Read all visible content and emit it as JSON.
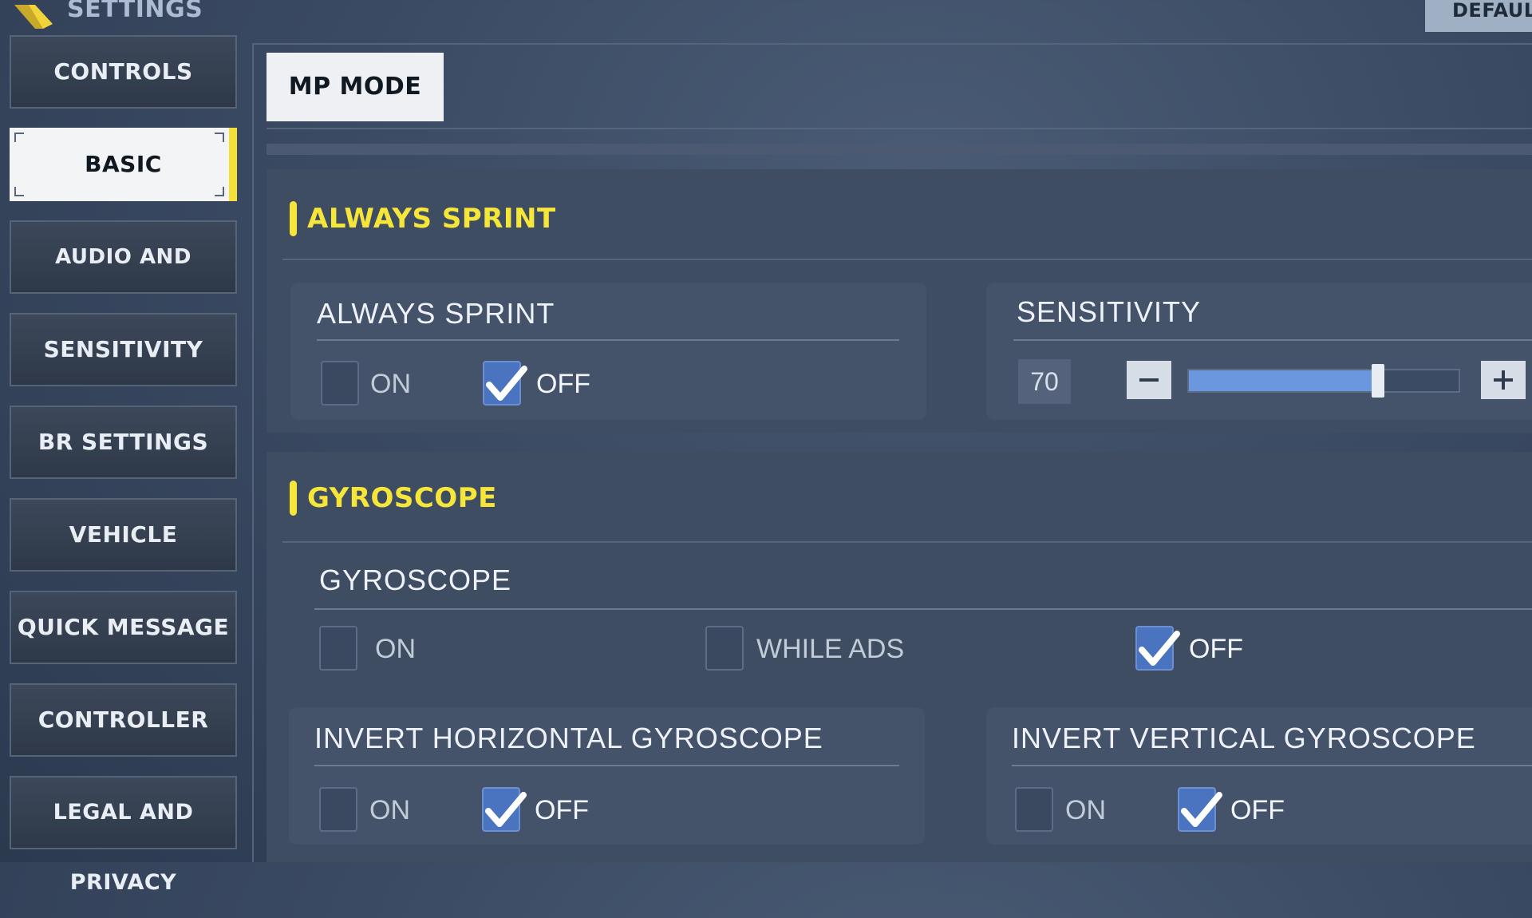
{
  "header": {
    "title": "SETTINGS",
    "default_label": "DEFAULT"
  },
  "sidebar": {
    "items": [
      {
        "label": "CONTROLS",
        "active": false
      },
      {
        "label": "BASIC",
        "active": true
      },
      {
        "label": "AUDIO AND GRAPHICS",
        "active": false
      },
      {
        "label": "SENSITIVITY",
        "active": false
      },
      {
        "label": "BR SETTINGS",
        "active": false
      },
      {
        "label": "VEHICLE SETTINGS",
        "active": false
      },
      {
        "label": "QUICK MESSAGE",
        "active": false
      },
      {
        "label": "CONTROLLER",
        "active": false
      },
      {
        "label": "LEGAL AND PRIVACY",
        "active": false
      }
    ]
  },
  "tabs": {
    "mp_mode": "MP MODE"
  },
  "always_sprint_section": {
    "title": "ALWAYS SPRINT",
    "always_sprint": {
      "title": "ALWAYS SPRINT",
      "options": [
        {
          "label": "ON",
          "checked": false
        },
        {
          "label": "OFF",
          "checked": true
        }
      ]
    },
    "sensitivity": {
      "title": "SENSITIVITY",
      "value": "70",
      "level_percent": 70
    }
  },
  "gyroscope_section": {
    "title": "GYROSCOPE",
    "gyroscope": {
      "title": "GYROSCOPE",
      "options": [
        {
          "label": "ON",
          "checked": false
        },
        {
          "label": "WHILE ADS",
          "checked": false
        },
        {
          "label": "OFF",
          "checked": true
        }
      ]
    },
    "invert_horizontal": {
      "title": "INVERT HORIZONTAL GYROSCOPE",
      "options": [
        {
          "label": "ON",
          "checked": false
        },
        {
          "label": "OFF",
          "checked": true
        }
      ]
    },
    "invert_vertical": {
      "title": "INVERT VERTICAL GYROSCOPE",
      "options": [
        {
          "label": "ON",
          "checked": false
        },
        {
          "label": "OFF",
          "checked": true
        }
      ]
    }
  },
  "colors": {
    "accent_yellow": "#f6e63a",
    "checkbox_blue": "#4a74bf",
    "slider_fill": "#6a97dd"
  }
}
